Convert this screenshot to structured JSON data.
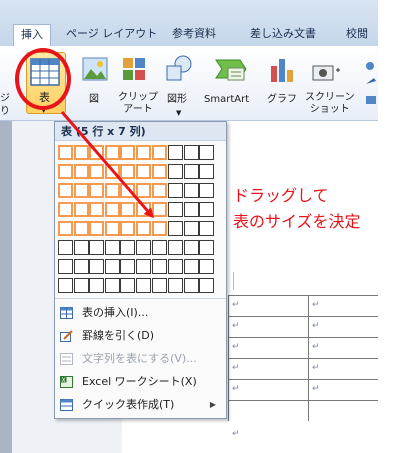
{
  "ribbon": {
    "tabs": [
      {
        "label": "挿入",
        "active": true
      },
      {
        "label": "ページ レイアウト",
        "active": false
      },
      {
        "label": "参考資料",
        "active": false
      },
      {
        "label": "差し込み文書",
        "active": false
      },
      {
        "label": "校閲",
        "active": false
      }
    ],
    "left_partial_labels": [
      "ジ",
      "り"
    ],
    "buttons": {
      "table": "表",
      "picture": "図",
      "clipart": "クリップ\nアート",
      "shapes": "図形",
      "smartart": "SmartArt",
      "chart": "グラフ",
      "screenshot": "スクリーン\nショット"
    }
  },
  "table_menu": {
    "header": "表 (5 行 x 7 列)",
    "grid": {
      "rows": 8,
      "cols": 10,
      "selected_rows": 5,
      "selected_cols": 7
    },
    "items": [
      {
        "label": "表の挿入(I)...",
        "icon": "insert-table-icon",
        "disabled": false,
        "submenu": false
      },
      {
        "label": "罫線を引く(D)",
        "icon": "draw-table-icon",
        "disabled": false,
        "submenu": false
      },
      {
        "label": "文字列を表にする(V)...",
        "icon": "text-to-table-icon",
        "disabled": true,
        "submenu": false
      },
      {
        "label": "Excel ワークシート(X)",
        "icon": "excel-icon",
        "disabled": false,
        "submenu": false
      },
      {
        "label": "クイック表作成(T)",
        "icon": "quick-table-icon",
        "disabled": false,
        "submenu": true
      }
    ]
  },
  "document": {
    "paragraph_mark": "↵",
    "rows": 5
  },
  "annotation": {
    "line1": "ドラッグして",
    "line2": "表のサイズを決定",
    "color": "#e8141a"
  },
  "colors": {
    "highlight_cell": "#f59a4f",
    "accent_red": "#e8141a",
    "ribbon_selected": "#ffd060"
  }
}
